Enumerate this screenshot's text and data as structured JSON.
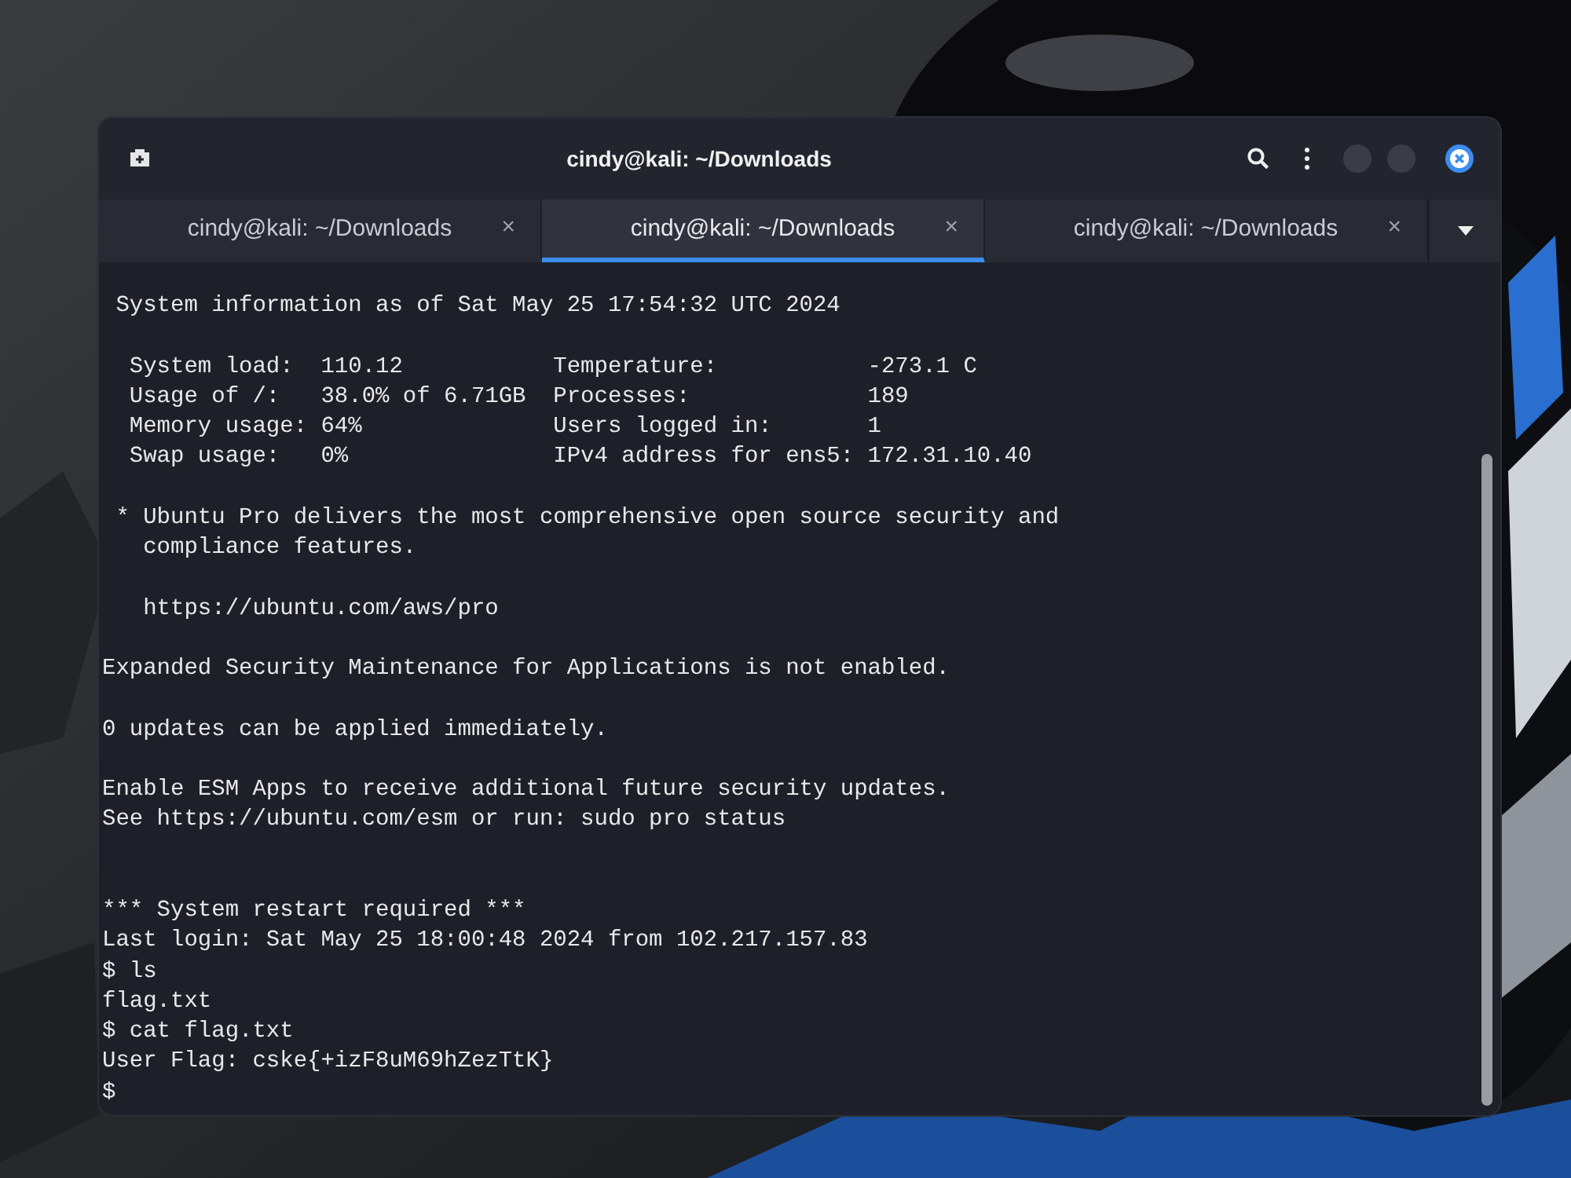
{
  "window": {
    "title": "cindy@kali: ~/Downloads"
  },
  "tabs": [
    {
      "label": "cindy@kali: ~/Downloads",
      "close": "×",
      "selected": false
    },
    {
      "label": "cindy@kali: ~/Downloads",
      "close": "×",
      "selected": true
    },
    {
      "label": "cindy@kali: ~/Downloads",
      "close": "×",
      "selected": false
    }
  ],
  "terminal": {
    "lines": [
      {
        "kind": "text",
        "text": " System information as of Sat May 25 17:54:32 UTC 2024"
      },
      {
        "kind": "blank"
      },
      {
        "kind": "text",
        "text": "  System load:  110.12           Temperature:           -273.1 C"
      },
      {
        "kind": "text",
        "text": "  Usage of /:   38.0% of 6.71GB  Processes:             189"
      },
      {
        "kind": "text",
        "text": "  Memory usage: 64%              Users logged in:       1"
      },
      {
        "kind": "text",
        "text": "  Swap usage:   0%               IPv4 address for ens5: 172.31.10.40"
      },
      {
        "kind": "blank"
      },
      {
        "kind": "text",
        "text": " * Ubuntu Pro delivers the most comprehensive open source security and"
      },
      {
        "kind": "text",
        "text": "   compliance features."
      },
      {
        "kind": "blank"
      },
      {
        "kind": "text",
        "text": "   https://ubuntu.com/aws/pro"
      },
      {
        "kind": "blank"
      },
      {
        "kind": "text",
        "text": "Expanded Security Maintenance for Applications is not enabled."
      },
      {
        "kind": "blank"
      },
      {
        "kind": "text",
        "text": "0 updates can be applied immediately."
      },
      {
        "kind": "blank"
      },
      {
        "kind": "text",
        "text": "Enable ESM Apps to receive additional future security updates."
      },
      {
        "kind": "text",
        "text": "See https://ubuntu.com/esm or run: sudo pro status"
      },
      {
        "kind": "blank"
      },
      {
        "kind": "blank"
      },
      {
        "kind": "text",
        "text": "*** System restart required ***"
      },
      {
        "kind": "text",
        "text": "Last login: Sat May 25 18:00:48 2024 from 102.217.157.83"
      },
      {
        "kind": "text",
        "text": "$ ls"
      },
      {
        "kind": "text",
        "text": "flag.txt"
      },
      {
        "kind": "text",
        "text": "$ cat flag.txt"
      },
      {
        "kind": "text",
        "text": "User Flag: cske{+izF8uM69hZezTtK}"
      },
      {
        "kind": "text",
        "text": "$"
      }
    ]
  }
}
